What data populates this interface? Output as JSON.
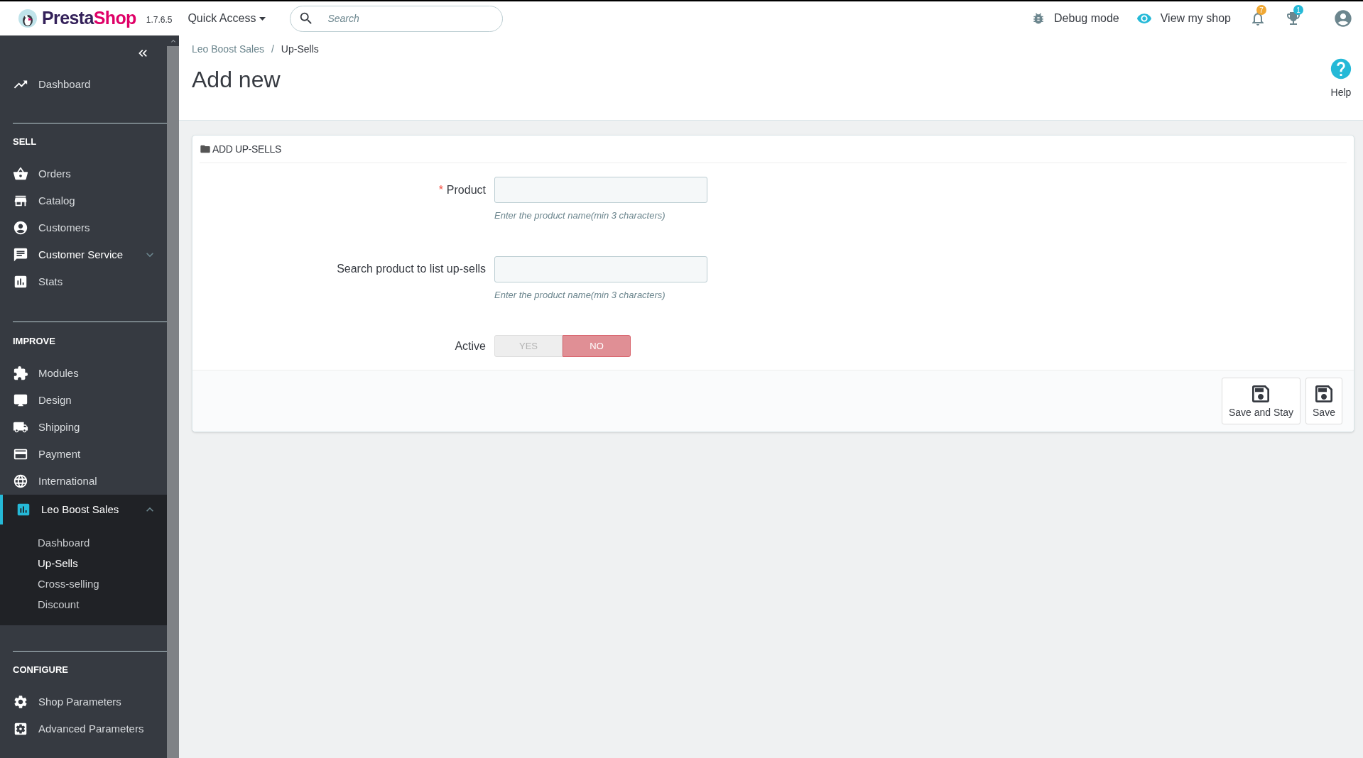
{
  "header": {
    "logo": [
      "Presta",
      "Shop"
    ],
    "version": "1.7.6.5",
    "quick_access": "Quick Access",
    "search": {
      "placeholder": "Search"
    },
    "debug_mode": "Debug mode",
    "view_shop": "View my shop",
    "notifications_badge": "7",
    "achievements_badge": "1"
  },
  "sidebar": {
    "sections": [
      {
        "items": [
          {
            "label": "Dashboard",
            "selected": false
          }
        ]
      },
      {
        "heading": "SELL",
        "items": [
          {
            "label": "Orders",
            "selected": false
          },
          {
            "label": "Catalog",
            "selected": false
          },
          {
            "label": "Customers",
            "selected": false
          },
          {
            "label": "Customer Service",
            "selected": false,
            "expanded": false
          },
          {
            "label": "Stats",
            "selected": false
          }
        ]
      },
      {
        "heading": "IMPROVE",
        "items": [
          {
            "label": "Modules",
            "selected": false
          },
          {
            "label": "Design",
            "selected": false
          },
          {
            "label": "Shipping",
            "selected": false
          },
          {
            "label": "Payment",
            "selected": false
          },
          {
            "label": "International",
            "selected": false
          },
          {
            "label": "Leo Boost Sales",
            "selected": true,
            "expanded": true,
            "children": [
              {
                "label": "Dashboard",
                "selected": false
              },
              {
                "label": "Up-Sells",
                "selected": true
              },
              {
                "label": "Cross-selling",
                "selected": false
              },
              {
                "label": "Discount",
                "selected": false
              }
            ]
          }
        ]
      },
      {
        "heading": "CONFIGURE",
        "items": [
          {
            "label": "Shop Parameters",
            "selected": false
          },
          {
            "label": "Advanced Parameters",
            "selected": false
          }
        ]
      }
    ]
  },
  "breadcrumb": [
    "Leo Boost Sales",
    "Up-Sells"
  ],
  "breadcrumb_separator": "/",
  "page_title": "Add new",
  "help": "Help",
  "panel": {
    "title": "ADD UP-SELLS",
    "fields": [
      {
        "kind": "text",
        "label": "Product",
        "required": true,
        "required_mark": "*",
        "hint": "Enter the product name(min 3 characters)"
      },
      {
        "kind": "text",
        "label": "Search product to list up-sells",
        "required": false,
        "hint": "Enter the product name(min 3 characters)"
      },
      {
        "kind": "switch",
        "label": "Active",
        "options": [
          {
            "label": "YES",
            "selected": false
          },
          {
            "label": "NO",
            "selected": true
          }
        ]
      }
    ],
    "buttons": [
      "Save and Stay",
      "Save"
    ]
  }
}
